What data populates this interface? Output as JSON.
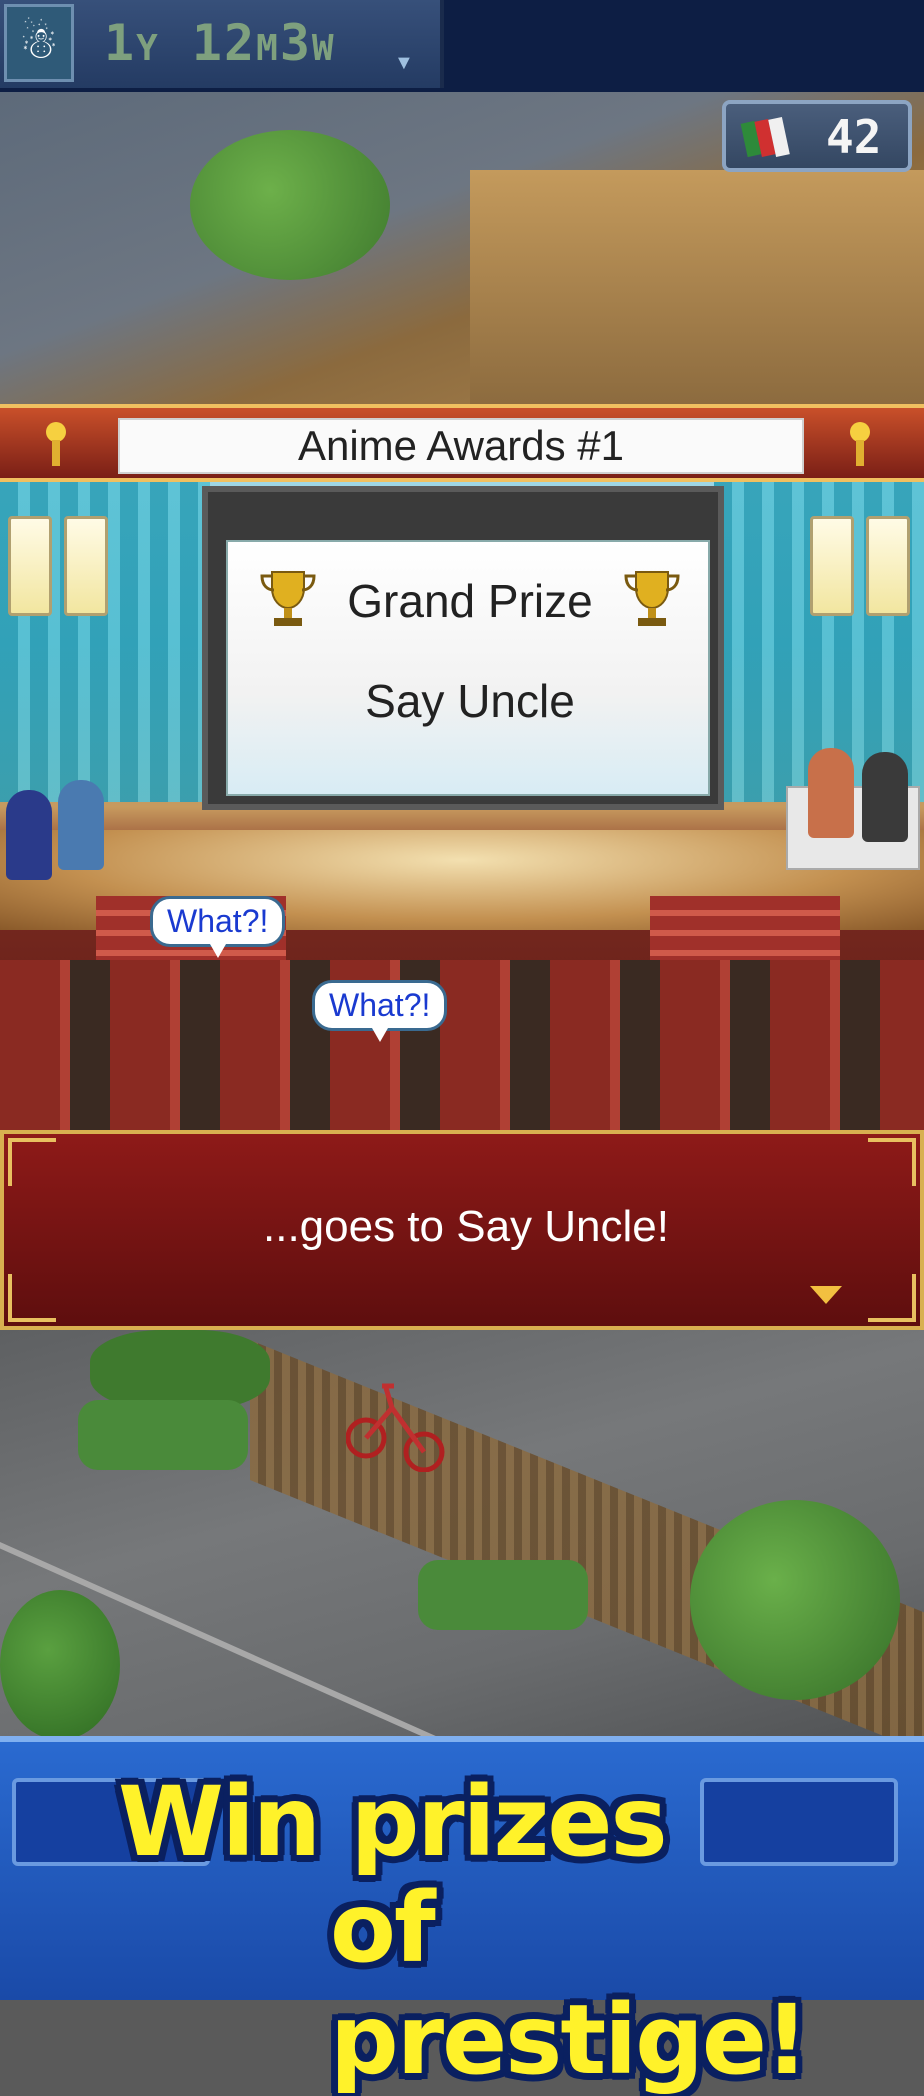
{
  "hud": {
    "date": {
      "year": "1",
      "year_unit": "Y",
      "month": "12",
      "month_unit": "M",
      "week": "3",
      "week_unit": "W"
    },
    "resource_value": "42",
    "icons": {
      "avatar": "snowman-icon",
      "resource": "books-icon",
      "date_menu": "chevron-down-icon"
    }
  },
  "award": {
    "banner_title": "Anime Awards #1",
    "prize_title": "Grand Prize",
    "winner": "Say Uncle",
    "icons": {
      "trophy": "trophy-icon",
      "torch": "torch-icon"
    }
  },
  "speech_bubbles": [
    "What?!",
    "What?!"
  ],
  "dialog": {
    "text": "...goes to Say Uncle!",
    "next_icon": "triangle-down-icon"
  },
  "promo": {
    "line1": "Win prizes",
    "line2": "of prestige!"
  },
  "colors": {
    "dialog_bg": "#8e1a18",
    "promo_text": "#fff22a",
    "promo_bg": "#2a6ad0",
    "speech_text": "#1a3ad0"
  }
}
